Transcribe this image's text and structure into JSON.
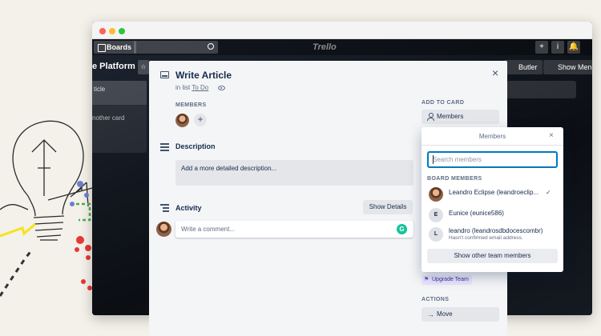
{
  "window": {
    "app_logo": "Trello"
  },
  "topbar": {
    "boards_label": "Boards",
    "plus_symbol": "+",
    "info_symbol": "i"
  },
  "board": {
    "title_fragment": "e Platform",
    "butler_label": "Butler",
    "show_menu_label": "Show Menu",
    "left_card_fragment": "ticle",
    "left_add_fragment": "nother card",
    "right_card_fragment": "ist"
  },
  "card": {
    "title": "Write Article",
    "in_list_prefix": "in list",
    "list_name": "To Do",
    "members_label": "MEMBERS",
    "add_member_symbol": "+",
    "description_title": "Description",
    "description_placeholder": "Add a more detailed description...",
    "activity_title": "Activity",
    "show_details_label": "Show Details",
    "comment_placeholder": "Write a comment...",
    "grammarly_letter": "G",
    "close_symbol": "×"
  },
  "sidebar": {
    "add_to_card_label": "ADD TO CARD",
    "members_button": "Members",
    "upgrade_team_label": "Upgrade Team",
    "actions_label": "ACTIONS",
    "move_button": "Move"
  },
  "members_popover": {
    "title": "Members",
    "close_symbol": "×",
    "search_placeholder": "Search members",
    "board_members_label": "BOARD MEMBERS",
    "members": [
      {
        "name": "Leandro Eclipse (leandroeclip...",
        "sub": "",
        "initial": "",
        "selected": true
      },
      {
        "name": "Eunice (eunice586)",
        "sub": "",
        "initial": "E",
        "selected": false
      },
      {
        "name": "leandro (leandrosdbdocescombr)",
        "sub": "Hasn't confirmed email address.",
        "initial": "L",
        "selected": false
      }
    ],
    "check_symbol": "✓",
    "show_other_label": "Show other team members"
  }
}
